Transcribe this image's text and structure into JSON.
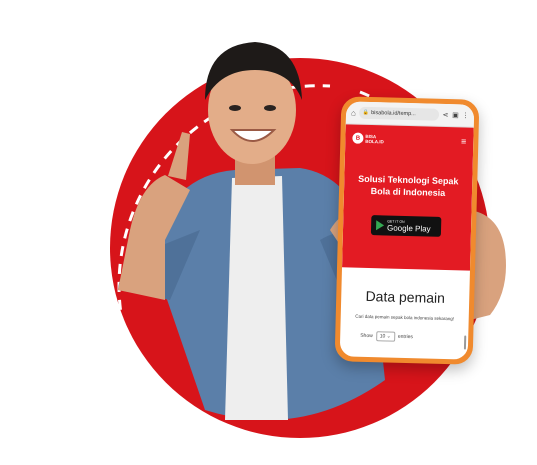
{
  "browser": {
    "url": "bisabola.id/temp...",
    "icons": [
      "home-icon",
      "lock-icon",
      "share-icon",
      "tabs-icon",
      "more-icon"
    ]
  },
  "site": {
    "logo_text": "BISA BOLA.ID",
    "logo_mark": "B",
    "headline": "Solusi Teknologi Sepak Bola di Indonesia",
    "store_badge": {
      "small": "GET IT ON",
      "big": "Google Play"
    },
    "section_title": "Data pemain",
    "section_subtitle": "Cari data pemain sepak bola indonesia sekarang!",
    "show_label": "Show",
    "entries_value": "10",
    "entries_label": "entries"
  },
  "colors": {
    "brand_red": "#e31b23",
    "phone_frame": "#f08a2e",
    "circle_red": "#d7141a"
  }
}
